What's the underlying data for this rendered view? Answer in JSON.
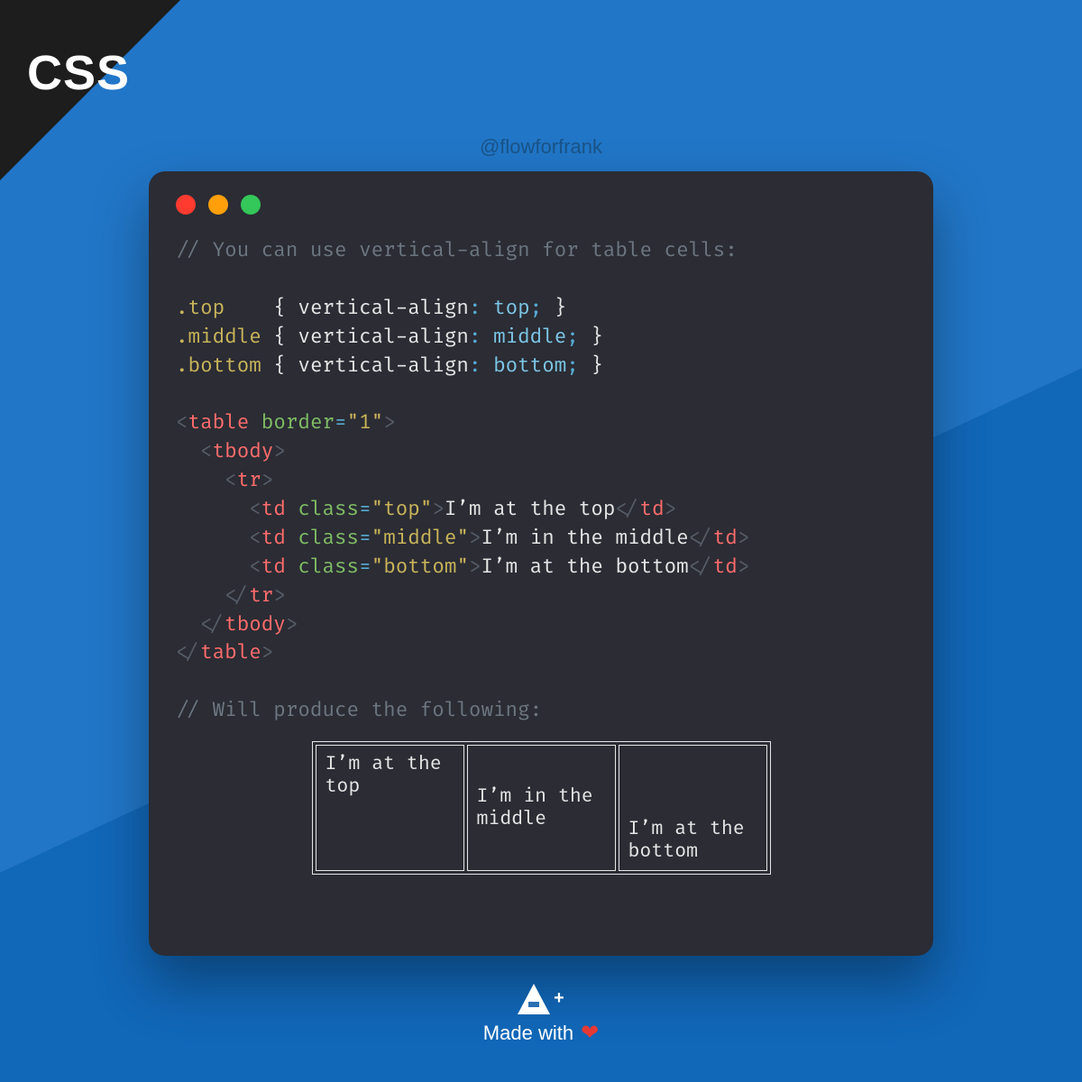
{
  "badge": "CSS",
  "handle": "@flowforfrank",
  "code": {
    "comment1": "// You can use vertical-align for table cells:",
    "rule_top": {
      "selector": ".top",
      "prop": "vertical-align",
      "value": "top"
    },
    "rule_middle": {
      "selector": ".middle",
      "prop": "vertical-align",
      "value": "middle"
    },
    "rule_bottom": {
      "selector": ".bottom",
      "prop": "vertical-align",
      "value": "bottom"
    },
    "tag_table": "table",
    "attr_border": "border",
    "val_border": "1",
    "tag_tbody": "tbody",
    "tag_tr": "tr",
    "tag_td": "td",
    "attr_class": "class",
    "cls_top": "top",
    "cls_middle": "middle",
    "cls_bottom": "bottom",
    "text_top": "I’m at the top",
    "text_middle": "I’m in the middle",
    "text_bottom": "I’m at the bottom",
    "comment2": "// Will produce the following:"
  },
  "demo": {
    "cell_top": "I’m at the top",
    "cell_middle": "I’m in the middle",
    "cell_bottom": "I’m at the bottom"
  },
  "footer": {
    "made_with": "Made with",
    "heart": "❤"
  }
}
